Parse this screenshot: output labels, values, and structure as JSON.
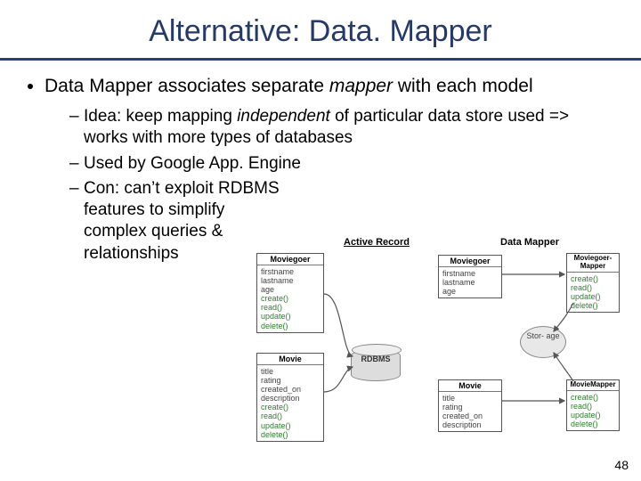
{
  "title": "Alternative: Data. Mapper",
  "bullet_main_pre": "Data Mapper associates separate ",
  "bullet_main_em": "mapper",
  "bullet_main_post": " with each model",
  "dash1_pre": "Idea: keep mapping ",
  "dash1_em": "independent",
  "dash1_post": " of particular data store used => works with more types of databases",
  "dash2": "Used by Google App. Engine",
  "dash3": "Con: can’t exploit RDBMS features to simplify complex queries & relationships",
  "pagenum": "48",
  "diagram": {
    "col_ar": "Active Record",
    "col_dm": "Data Mapper",
    "ar": {
      "mg_head": "Moviegoer",
      "mg_fields": [
        "firstname",
        "lastname",
        "age"
      ],
      "mg_methods": [
        "create()",
        "read()",
        "update()",
        "delete()"
      ],
      "mv_head": "Movie",
      "mv_fields": [
        "title",
        "rating",
        "created_on",
        "description"
      ],
      "mv_methods": [
        "create()",
        "read()",
        "update()",
        "delete()"
      ],
      "db": "RDBMS"
    },
    "dm": {
      "mg_head": "Moviegoer",
      "mg_fields": [
        "firstname",
        "lastname",
        "age"
      ],
      "mgmap_head": "Moviegoer-Mapper",
      "mgmap_methods": [
        "create()",
        "read()",
        "update()",
        "delete()"
      ],
      "mv_head": "Movie",
      "mv_fields": [
        "title",
        "rating",
        "created_on",
        "description"
      ],
      "mvmap_head": "MovieMapper",
      "mvmap_methods": [
        "create()",
        "read()",
        "update()",
        "delete()"
      ],
      "storage": "Stor-\nage"
    }
  }
}
